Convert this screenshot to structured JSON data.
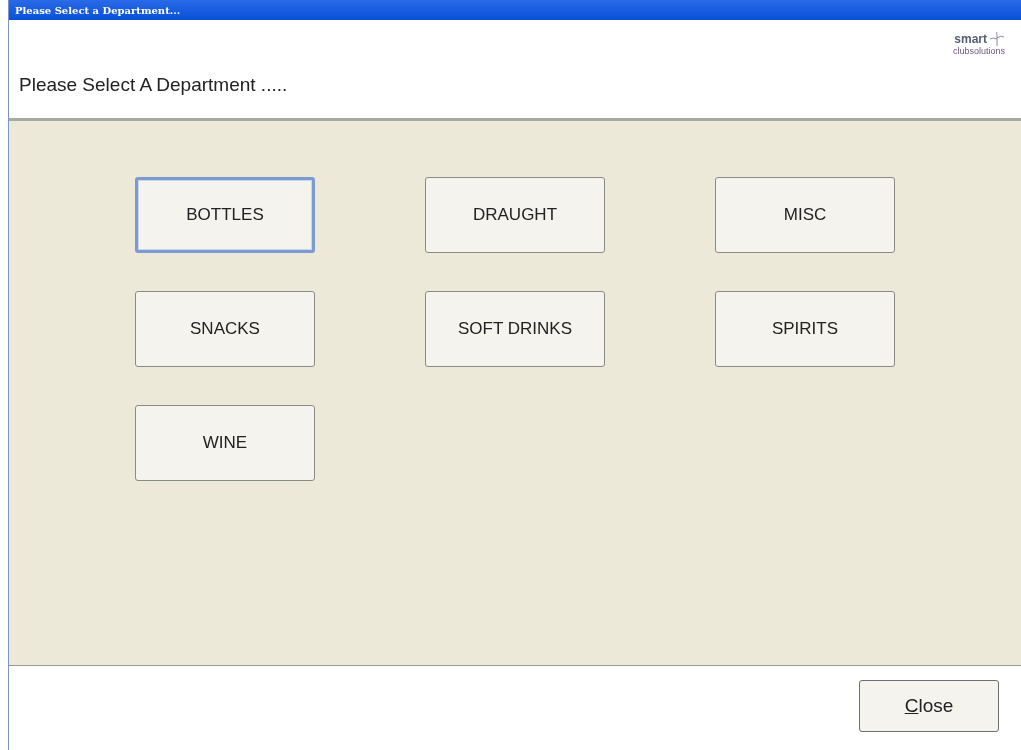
{
  "window": {
    "title": "Please Select a Department..."
  },
  "header": {
    "heading": "Please Select A Department .....",
    "logo": {
      "name": "smart",
      "tagline": "clubsolutions"
    }
  },
  "departments": [
    {
      "label": "BOTTLES",
      "focused": true
    },
    {
      "label": "DRAUGHT",
      "focused": false
    },
    {
      "label": "MISC",
      "focused": false
    },
    {
      "label": "SNACKS",
      "focused": false
    },
    {
      "label": "SOFT DRINKS",
      "focused": false
    },
    {
      "label": "SPIRITS",
      "focused": false
    },
    {
      "label": "WINE",
      "focused": false
    }
  ],
  "footer": {
    "close_button": {
      "label_parts": [
        {
          "text": "C",
          "underlined": true
        },
        {
          "text": "lose",
          "underlined": false
        }
      ]
    }
  }
}
